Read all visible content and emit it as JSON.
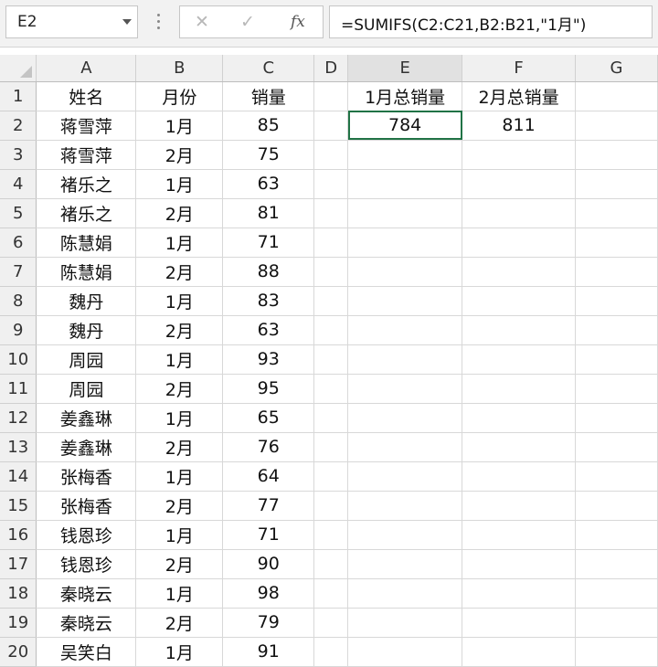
{
  "name_box": "E2",
  "toolbar": {
    "cancel_glyph": "✕",
    "enter_glyph": "✓",
    "fx_label": "fx"
  },
  "formula": "=SUMIFS(C2:C21,B2:B21,\"1月\")",
  "columns": [
    "A",
    "B",
    "C",
    "D",
    "E",
    "F",
    "G"
  ],
  "rows": [
    {
      "num": "1",
      "a": "姓名",
      "b": "月份",
      "c": "销量",
      "d": "",
      "e": "1月总销量",
      "f": "2月总销量",
      "g": ""
    },
    {
      "num": "2",
      "a": "蒋雪萍",
      "b": "1月",
      "c": "85",
      "d": "",
      "e": "784",
      "f": "811",
      "g": ""
    },
    {
      "num": "3",
      "a": "蒋雪萍",
      "b": "2月",
      "c": "75",
      "d": "",
      "e": "",
      "f": "",
      "g": ""
    },
    {
      "num": "4",
      "a": "褚乐之",
      "b": "1月",
      "c": "63",
      "d": "",
      "e": "",
      "f": "",
      "g": ""
    },
    {
      "num": "5",
      "a": "褚乐之",
      "b": "2月",
      "c": "81",
      "d": "",
      "e": "",
      "f": "",
      "g": ""
    },
    {
      "num": "6",
      "a": "陈慧娟",
      "b": "1月",
      "c": "71",
      "d": "",
      "e": "",
      "f": "",
      "g": ""
    },
    {
      "num": "7",
      "a": "陈慧娟",
      "b": "2月",
      "c": "88",
      "d": "",
      "e": "",
      "f": "",
      "g": ""
    },
    {
      "num": "8",
      "a": "魏丹",
      "b": "1月",
      "c": "83",
      "d": "",
      "e": "",
      "f": "",
      "g": ""
    },
    {
      "num": "9",
      "a": "魏丹",
      "b": "2月",
      "c": "63",
      "d": "",
      "e": "",
      "f": "",
      "g": ""
    },
    {
      "num": "10",
      "a": "周园",
      "b": "1月",
      "c": "93",
      "d": "",
      "e": "",
      "f": "",
      "g": ""
    },
    {
      "num": "11",
      "a": "周园",
      "b": "2月",
      "c": "95",
      "d": "",
      "e": "",
      "f": "",
      "g": ""
    },
    {
      "num": "12",
      "a": "姜鑫琳",
      "b": "1月",
      "c": "65",
      "d": "",
      "e": "",
      "f": "",
      "g": ""
    },
    {
      "num": "13",
      "a": "姜鑫琳",
      "b": "2月",
      "c": "76",
      "d": "",
      "e": "",
      "f": "",
      "g": ""
    },
    {
      "num": "14",
      "a": "张梅香",
      "b": "1月",
      "c": "64",
      "d": "",
      "e": "",
      "f": "",
      "g": ""
    },
    {
      "num": "15",
      "a": "张梅香",
      "b": "2月",
      "c": "77",
      "d": "",
      "e": "",
      "f": "",
      "g": ""
    },
    {
      "num": "16",
      "a": "钱恩珍",
      "b": "1月",
      "c": "71",
      "d": "",
      "e": "",
      "f": "",
      "g": ""
    },
    {
      "num": "17",
      "a": "钱恩珍",
      "b": "2月",
      "c": "90",
      "d": "",
      "e": "",
      "f": "",
      "g": ""
    },
    {
      "num": "18",
      "a": "秦晓云",
      "b": "1月",
      "c": "98",
      "d": "",
      "e": "",
      "f": "",
      "g": ""
    },
    {
      "num": "19",
      "a": "秦晓云",
      "b": "2月",
      "c": "79",
      "d": "",
      "e": "",
      "f": "",
      "g": ""
    },
    {
      "num": "20",
      "a": "吴笑白",
      "b": "1月",
      "c": "91",
      "d": "",
      "e": "",
      "f": "",
      "g": ""
    }
  ]
}
